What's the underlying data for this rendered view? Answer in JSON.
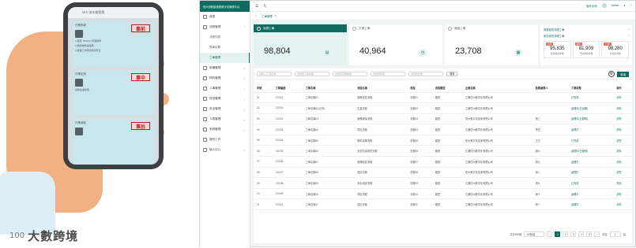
{
  "illustration": {
    "phone_header": "MIS 流水線管理",
    "cards": [
      {
        "stamp": "事前",
        "title": "作業指導",
        "lines": [
          "1.檢查 TRW4.0 管理標準",
          "2.確認物料與設備",
          "3.確保工作環境整潔安全"
        ]
      },
      {
        "stamp": "事中",
        "title": "作業記錄",
        "lines": [
          "記錄生產狀態"
        ]
      },
      {
        "stamp": "事后",
        "title": "作業總結",
        "lines": []
      }
    ],
    "brand_logo": "100",
    "brand_name": "大數跨境"
  },
  "app": {
    "logo": "億州流程製造業數字化管理平台",
    "sidebar": [
      {
        "label": "首頁",
        "icon": "home-icon",
        "children": []
      },
      {
        "label": "流程管理",
        "icon": "flow-icon",
        "children": [
          "流程列表",
          "表單定義",
          "工單管理"
        ]
      },
      {
        "label": "設備管理",
        "icon": "device-icon",
        "children": []
      },
      {
        "label": "物料管理",
        "icon": "box-icon",
        "children": []
      },
      {
        "label": "人事管理",
        "icon": "people-icon",
        "children": []
      },
      {
        "label": "質檢管理",
        "icon": "check-icon",
        "children": []
      },
      {
        "label": "安全管理",
        "icon": "shield-icon",
        "children": []
      },
      {
        "label": "人員管理",
        "icon": "user-icon",
        "children": []
      },
      {
        "label": "系統管理",
        "icon": "gear-icon",
        "children": []
      },
      {
        "label": "我的工作",
        "icon": "work-icon",
        "children": []
      },
      {
        "label": "個人中心",
        "icon": "person-icon",
        "children": []
      }
    ],
    "active_sub": "工單管理",
    "topright": {
      "doc_link": "操作手冊",
      "user": "Admin"
    },
    "tabs": [
      "首頁",
      "工單管理"
    ],
    "cards": [
      {
        "label": "待辦工單",
        "value": "98,804"
      },
      {
        "label": "已辦工單",
        "value": "40,964"
      },
      {
        "label": "我創工單",
        "value": "23,708"
      }
    ],
    "quick_links": [
      "我發起的流程工單",
      "來自我的流程工單"
    ],
    "stats": [
      {
        "badge": "待辦",
        "value": "95,835",
        "label": "我參與的流程"
      },
      {
        "badge": "超時",
        "value": "81,909",
        "label": "已提醒的流程"
      },
      {
        "badge": "已辦",
        "value": "98,280",
        "label": "已辦的流程"
      }
    ],
    "filters": [
      "請輸入工單名稱",
      "請選擇工單狀態",
      "請選擇流程類型",
      "請選擇時間",
      "請選擇企業"
    ],
    "query_label": "搜索",
    "add_label": "新增",
    "columns": [
      "序號",
      "工單編號",
      "工單名稱",
      "流程名稱",
      "流程",
      "流程類型",
      "企業名稱",
      "負責處理人",
      "工單狀態",
      "操作"
    ],
    "rows": [
      [
        "01",
        "CX101",
        "工單名稱01",
        "設備巡檢流程",
        "流程01",
        "類型",
        "江蘇億州數字化有限公司",
        "",
        "已完成",
        "詳情"
      ],
      [
        "02",
        "CX101",
        "工單名稱02(已完)",
        "生產流程",
        "流程02",
        "類型",
        "江蘇億州數字化有限公司",
        "",
        "處理中(已逾期)",
        "詳情"
      ],
      [
        "03",
        "CX102",
        "工單名稱03",
        "設備維保流程",
        "流程03",
        "類型",
        "億州數字化技術有限公司",
        "張三",
        "處理中(已超時)",
        "詳情"
      ],
      [
        "04",
        "CX103",
        "工單名稱04",
        "質檢流程",
        "流程04",
        "類型",
        "江蘇億州數字化有限公司",
        "李四",
        "處理中",
        "詳情"
      ],
      [
        "05",
        "CX104",
        "工單名稱05",
        "物料採購流程",
        "流程05",
        "類型",
        "億州數字化技術有限公司",
        "王五",
        "已完成",
        "詳情"
      ],
      [
        "06",
        "CX105",
        "工單名稱06",
        "安全隱患排查流程",
        "流程06",
        "類型",
        "江蘇億州數字化有限公司",
        "趙六",
        "處理中(已超時)",
        "詳情"
      ],
      [
        "07",
        "CX106",
        "工單名稱07",
        "設備點檢流程",
        "流程07",
        "類型",
        "江蘇億州數字化有限公司",
        "錢七",
        "處理中",
        "詳情"
      ],
      [
        "08",
        "CX107",
        "工單名稱08",
        "巡檢流程",
        "流程08",
        "類型",
        "億州數字化技術有限公司",
        "孫八",
        "處理中",
        "詳情"
      ],
      [
        "09",
        "CX108",
        "工單名稱09",
        "安全培訓流程",
        "流程09",
        "類型",
        "江蘇億州數字化有限公司",
        "周九",
        "已完成",
        "詳情"
      ],
      [
        "10",
        "CX109",
        "工單名稱10",
        "質檢流程",
        "流程10",
        "類型",
        "江蘇億州數字化有限公司",
        "吳十",
        "處理中",
        "詳情"
      ],
      [
        "11",
        "CX110",
        "工單名稱11",
        "巡檢流程",
        "流程11",
        "類型",
        "江蘇億州數字化有限公司",
        "鄭一",
        "處理中",
        "詳情"
      ]
    ],
    "pager": {
      "total": "共計500條",
      "size": "10條/頁",
      "pages": [
        "1",
        "2",
        "3",
        "4",
        "5"
      ],
      "current": "1",
      "goto_label": "前往",
      "goto_value": "1",
      "page_unit": "頁"
    }
  }
}
